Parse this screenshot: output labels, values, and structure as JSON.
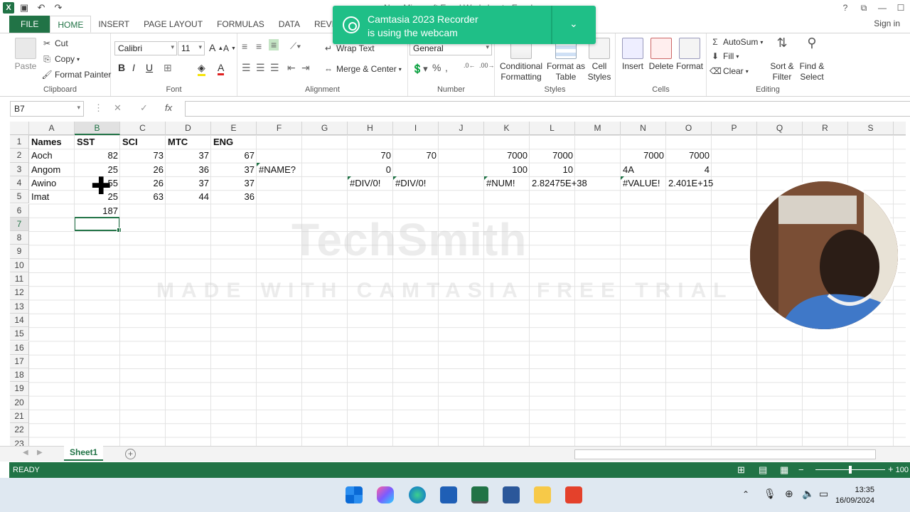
{
  "window": {
    "title": "New Microsoft Excel Worksheet - Excel"
  },
  "ribbon_tabs": [
    "FILE",
    "HOME",
    "INSERT",
    "PAGE LAYOUT",
    "FORMULAS",
    "DATA",
    "REVIEW"
  ],
  "signin": "Sign in",
  "clipboard": {
    "paste": "Paste",
    "cut": "Cut",
    "copy": "Copy",
    "format_painter": "Format Painter",
    "label": "Clipboard"
  },
  "font": {
    "name": "Calibri",
    "size": "11",
    "label": "Font"
  },
  "alignment": {
    "wrap": "Wrap Text",
    "merge": "Merge & Center",
    "label": "Alignment"
  },
  "number": {
    "format": "General",
    "label": "Number"
  },
  "styles": {
    "conditional": "Conditional Formatting",
    "format_table": "Format as Table",
    "cell_styles": "Cell Styles",
    "label": "Styles"
  },
  "cells_group": {
    "insert": "Insert",
    "delete": "Delete",
    "format": "Format",
    "label": "Cells"
  },
  "editing": {
    "autosum": "AutoSum",
    "fill": "Fill",
    "clear": "Clear",
    "sort": "Sort & Filter",
    "find": "Find & Select",
    "label": "Editing"
  },
  "toast": {
    "line1": "Camtasia 2023 Recorder",
    "line2": "is using the webcam"
  },
  "formula_bar": {
    "name_box": "B7",
    "fx": "fx",
    "content": ""
  },
  "columns": [
    "A",
    "B",
    "C",
    "D",
    "E",
    "F",
    "G",
    "H",
    "I",
    "J",
    "K",
    "L",
    "M",
    "N",
    "O",
    "P",
    "Q",
    "R",
    "S"
  ],
  "rows": [
    "1",
    "2",
    "3",
    "4",
    "5",
    "6",
    "7",
    "8",
    "9",
    "10",
    "11",
    "12",
    "13",
    "14",
    "15",
    "16",
    "17",
    "18",
    "19",
    "20",
    "21",
    "22",
    "23"
  ],
  "cells": {
    "A1": "Names",
    "B1": "SST",
    "C1": "SCI",
    "D1": "MTC",
    "E1": "ENG",
    "A2": "Aoch",
    "B2": "82",
    "C2": "73",
    "D2": "37",
    "E2": "67",
    "H2": "70",
    "I2": "70",
    "K2": "7000",
    "L2": "7000",
    "N2": "7000",
    "O2": "7000",
    "A3": "Angom",
    "B3": "25",
    "C3": "26",
    "D3": "36",
    "E3": "37",
    "F3": "#NAME?",
    "H3": "0",
    "K3": "100",
    "L3": "10",
    "N3": "4A",
    "O3": "4",
    "A4": "Awino",
    "B4": "55",
    "C4": "26",
    "D4": "37",
    "E4": "37",
    "H4": "#DIV/0!",
    "I4": "#DIV/0!",
    "K4": "#NUM!",
    "L4": "2.82475E+38",
    "N4": "#VALUE!",
    "O4": "2.401E+15",
    "A5": "Imat",
    "B5": "25",
    "C5": "63",
    "D5": "44",
    "E5": "36",
    "B6": "187"
  },
  "watermark": {
    "brand": "TechSmith",
    "tagline": "MADE WITH CAMTASIA FREE TRIAL"
  },
  "sheet_tab": "Sheet1",
  "status": {
    "text": "READY",
    "zoom": "100"
  },
  "tray": {
    "time": "13:35",
    "date": "16/09/2024"
  },
  "colors": {
    "excel_green": "#217346",
    "toast": "#1fbf87"
  }
}
